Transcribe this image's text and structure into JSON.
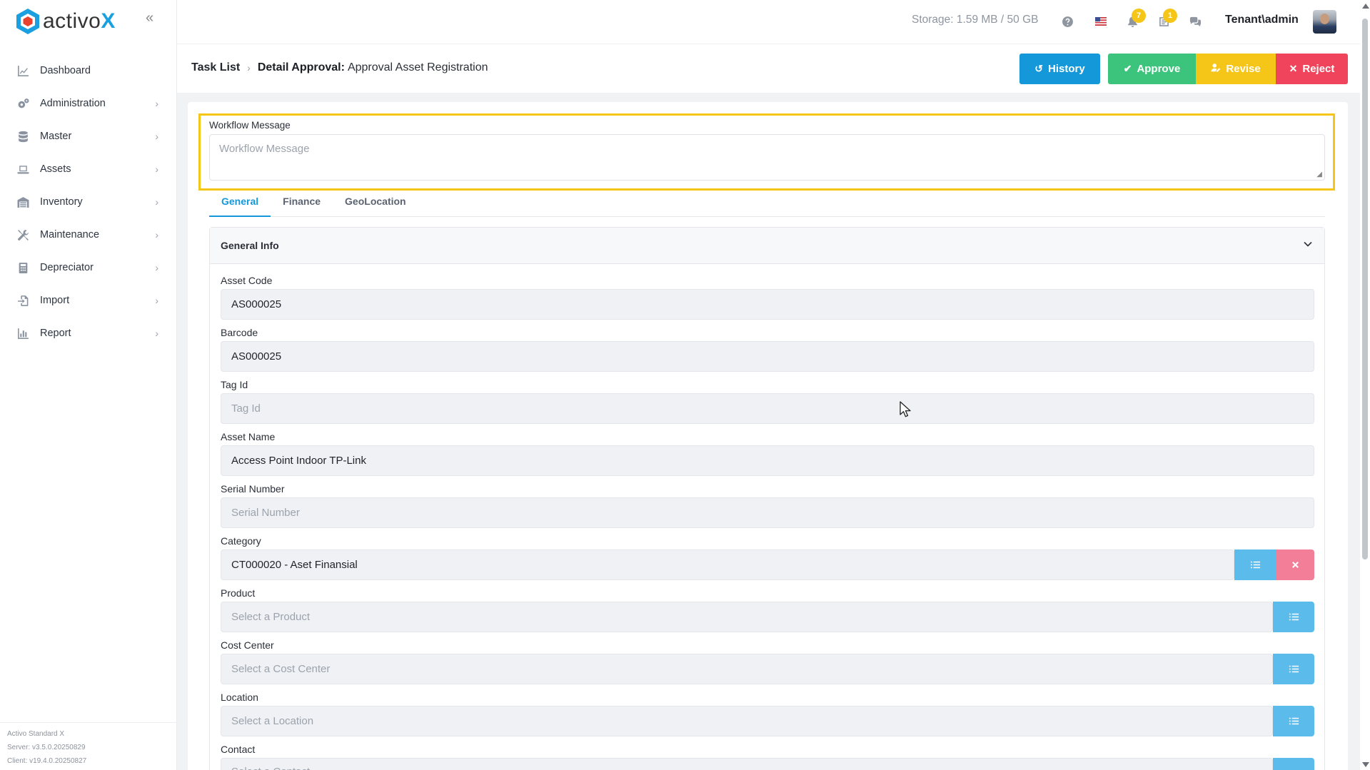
{
  "app": {
    "logo_text": "activo",
    "logo_accent": "X",
    "brand_color": "#1aa0e0"
  },
  "sidebar": {
    "items": [
      {
        "label": "Dashboard",
        "icon": "chart-line-icon",
        "has_children": false
      },
      {
        "label": "Administration",
        "icon": "cogs-icon",
        "has_children": true
      },
      {
        "label": "Master",
        "icon": "database-icon",
        "has_children": true
      },
      {
        "label": "Assets",
        "icon": "laptop-icon",
        "has_children": true
      },
      {
        "label": "Inventory",
        "icon": "warehouse-icon",
        "has_children": true
      },
      {
        "label": "Maintenance",
        "icon": "tools-icon",
        "has_children": true
      },
      {
        "label": "Depreciator",
        "icon": "calculator-icon",
        "has_children": true
      },
      {
        "label": "Import",
        "icon": "file-import-icon",
        "has_children": true
      },
      {
        "label": "Report",
        "icon": "chart-bar-icon",
        "has_children": true
      }
    ],
    "footer": {
      "edition": "Activo Standard X",
      "server": "Server: v3.5.0.20250829",
      "client": "Client: v19.4.0.20250827"
    }
  },
  "topbar": {
    "storage": "Storage: 1.59 MB / 50 GB",
    "notifications_count": "7",
    "tasks_count": "1",
    "user": "Tenant\\admin"
  },
  "header": {
    "breadcrumb_root": "Task List",
    "title_strong": "Detail Approval:",
    "title_rest": "Approval Asset Registration",
    "buttons": {
      "history": "History",
      "approve": "Approve",
      "revise": "Revise",
      "reject": "Reject"
    },
    "colors": {
      "history": "#1498da",
      "approve": "#3cc47c",
      "revise": "#f5c518",
      "reject": "#f0445c"
    }
  },
  "workflow": {
    "label": "Workflow Message",
    "placeholder": "Workflow Message",
    "highlight_color": "#f5c518"
  },
  "tabs": [
    "General",
    "Finance",
    "GeoLocation"
  ],
  "active_tab": "General",
  "section": {
    "title": "General Info"
  },
  "fields": {
    "asset_code": {
      "label": "Asset Code",
      "value": "AS000025"
    },
    "barcode": {
      "label": "Barcode",
      "value": "AS000025"
    },
    "tag_id": {
      "label": "Tag Id",
      "placeholder": "Tag Id"
    },
    "asset_name": {
      "label": "Asset Name",
      "value": "Access Point Indoor TP-Link"
    },
    "serial_number": {
      "label": "Serial Number",
      "placeholder": "Serial Number"
    },
    "category": {
      "label": "Category",
      "value": "CT000020 - Aset Finansial"
    },
    "product": {
      "label": "Product",
      "placeholder": "Select a Product"
    },
    "cost_center": {
      "label": "Cost Center",
      "placeholder": "Select a Cost Center"
    },
    "location": {
      "label": "Location",
      "placeholder": "Select a Location"
    },
    "contact": {
      "label": "Contact",
      "placeholder": "Select a Contact"
    }
  }
}
